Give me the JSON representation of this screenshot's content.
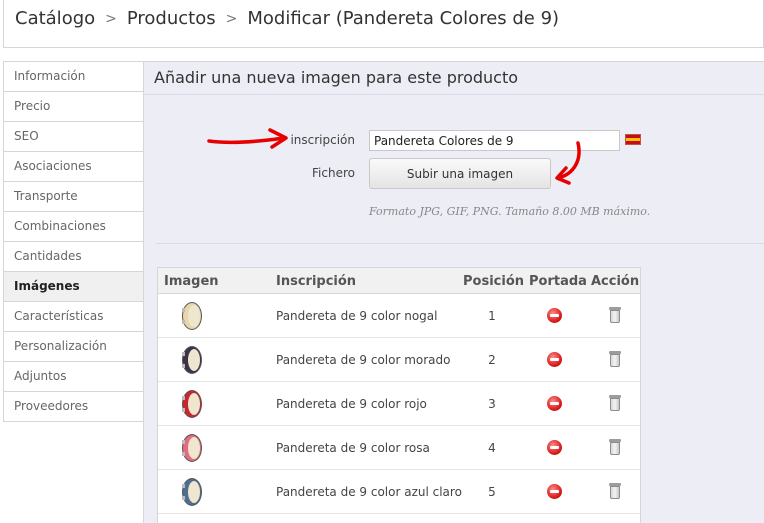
{
  "breadcrumb": {
    "items": [
      "Catálogo",
      "Productos",
      "Modificar (Pandereta Colores de 9)"
    ],
    "separator": ">"
  },
  "sidebar": {
    "items": [
      {
        "label": "Información"
      },
      {
        "label": "Precio"
      },
      {
        "label": "SEO"
      },
      {
        "label": "Asociaciones"
      },
      {
        "label": "Transporte"
      },
      {
        "label": "Combinaciones"
      },
      {
        "label": "Cantidades"
      },
      {
        "label": "Imágenes",
        "active": true
      },
      {
        "label": "Características"
      },
      {
        "label": "Personalización"
      },
      {
        "label": "Adjuntos"
      },
      {
        "label": "Proveedores"
      }
    ]
  },
  "main": {
    "title": "Añadir una nueva imagen para este producto",
    "form": {
      "caption_label": "inscripción",
      "caption_value": "Pandereta Colores de 9",
      "file_label": "Fichero",
      "upload_button": "Subir una imagen",
      "hint": "Formato JPG, GIF, PNG. Tamaño 8.00 MB máximo.",
      "language_flag": "spain-flag-icon"
    },
    "table": {
      "headers": [
        "Imagen",
        "Inscripción",
        "Posición",
        "Portada",
        "Acción"
      ],
      "rows": [
        {
          "caption": "Pandereta de 9 color nogal",
          "position": "1",
          "color": "#e7d6a6"
        },
        {
          "caption": "Pandereta de 9 color morado",
          "position": "2",
          "color": "#3d3348"
        },
        {
          "caption": "Pandereta de 9 color rojo",
          "position": "3",
          "color": "#c8262c"
        },
        {
          "caption": "Pandereta de 9 color rosa",
          "position": "4",
          "color": "#e56b7f"
        },
        {
          "caption": "Pandereta de 9 color azul claro",
          "position": "5",
          "color": "#4e6e93"
        }
      ],
      "cover_icon": "not-cover-icon",
      "delete_icon": "trash-icon"
    },
    "annotation_color": "#e60000"
  }
}
